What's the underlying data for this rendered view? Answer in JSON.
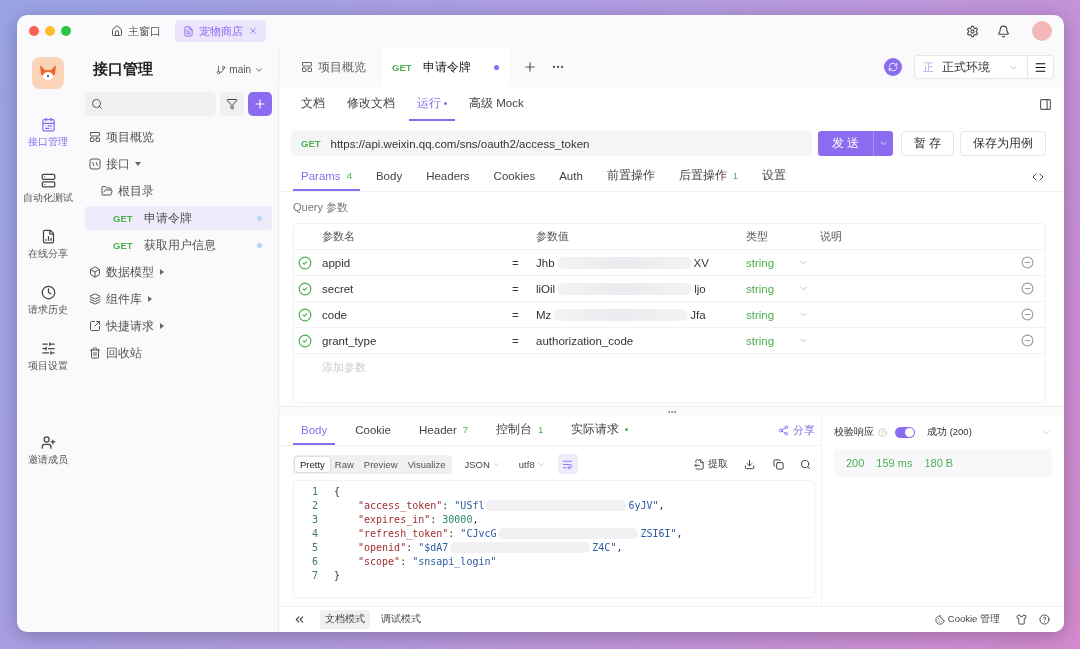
{
  "titlebar": {
    "tabs": [
      {
        "label": "主窗口",
        "selected": false
      },
      {
        "label": "宠物商店",
        "selected": true
      }
    ]
  },
  "rail": {
    "items": [
      {
        "label": "接口管理",
        "selected": true
      },
      {
        "label": "自动化测试",
        "selected": false
      },
      {
        "label": "在线分享",
        "selected": false
      },
      {
        "label": "请求历史",
        "selected": false
      },
      {
        "label": "项目设置",
        "selected": false
      },
      {
        "label": "邀请成员",
        "selected": false
      }
    ]
  },
  "sidebar": {
    "title": "接口管理",
    "branch": "main",
    "tree": [
      {
        "label": "项目概览",
        "kind": "page"
      },
      {
        "label": "接口",
        "kind": "group",
        "expanded": true,
        "children": [
          {
            "label": "根目录",
            "kind": "folder",
            "children": [
              {
                "kind": "api",
                "method": "GET",
                "label": "申请令牌",
                "selected": true
              },
              {
                "kind": "api",
                "method": "GET",
                "label": "获取用户信息",
                "selected": false
              }
            ]
          }
        ]
      },
      {
        "label": "数据模型",
        "kind": "group",
        "expanded": false
      },
      {
        "label": "组件库",
        "kind": "group",
        "expanded": false
      },
      {
        "label": "快捷请求",
        "kind": "group",
        "expanded": false
      },
      {
        "label": "回收站",
        "kind": "page"
      }
    ]
  },
  "doc_tabs": [
    {
      "kind": "overview",
      "label": "项目概览",
      "selected": false,
      "modified": false
    },
    {
      "kind": "api",
      "method": "GET",
      "label": "申请令牌",
      "selected": true,
      "modified": true
    }
  ],
  "environment": {
    "badge": "正",
    "label": "正式环境"
  },
  "sub_tabs": [
    {
      "label": "文档",
      "selected": false,
      "dot": false
    },
    {
      "label": "修改文档",
      "selected": false,
      "dot": false
    },
    {
      "label": "运行",
      "selected": true,
      "dot": true
    },
    {
      "label": "高级 Mock",
      "selected": false,
      "dot": false
    }
  ],
  "request": {
    "method": "GET",
    "url": "https://api.weixin.qq.com/sns/oauth2/access_token",
    "send": "发 送",
    "save": "暂 存",
    "save_case": "保存为用例"
  },
  "param_tabs": [
    {
      "label": "Params",
      "count": "4",
      "selected": true
    },
    {
      "label": "Body",
      "selected": false
    },
    {
      "label": "Headers",
      "selected": false
    },
    {
      "label": "Cookies",
      "selected": false
    },
    {
      "label": "Auth",
      "selected": false
    },
    {
      "label": "前置操作",
      "selected": false
    },
    {
      "label": "后置操作",
      "count": "1",
      "selected": false
    },
    {
      "label": "设置",
      "selected": false
    }
  ],
  "query": {
    "label": "Query 参数",
    "columns": [
      "参数名",
      "参数值",
      "类型",
      "说明"
    ],
    "rows": [
      {
        "enabled": true,
        "name": "appid",
        "operator": "=",
        "value_start": "Jhb",
        "masked": true,
        "value_end": "XV",
        "type": "string"
      },
      {
        "enabled": true,
        "name": "secret",
        "operator": "=",
        "value_start": "liOil",
        "masked": true,
        "value_end": "ljo",
        "type": "string"
      },
      {
        "enabled": true,
        "name": "code",
        "operator": "=",
        "value_start": "Mz",
        "masked": true,
        "value_end": "Jfa",
        "type": "string"
      },
      {
        "enabled": true,
        "name": "grant_type",
        "operator": "=",
        "value_start": "authorization_code",
        "masked": false,
        "type": "string"
      }
    ],
    "add_placeholder": "添加参数"
  },
  "response_tabs": [
    {
      "label": "Body",
      "selected": true,
      "dot": false
    },
    {
      "label": "Cookie",
      "selected": false,
      "dot": false
    },
    {
      "label": "Header",
      "count": "7",
      "selected": false,
      "dot": false
    },
    {
      "label": "控制台",
      "count": "1",
      "selected": false,
      "dot": false
    },
    {
      "label": "实际请求",
      "selected": false,
      "dot": true
    }
  ],
  "share": "分享",
  "view_modes": [
    {
      "label": "Pretty",
      "selected": true
    },
    {
      "label": "Raw",
      "selected": false
    },
    {
      "label": "Preview",
      "selected": false
    },
    {
      "label": "Visualize",
      "selected": false
    }
  ],
  "format": "JSON",
  "encoding": "utf8",
  "extract": "提取",
  "code": [
    {
      "n": "1",
      "tokens": [
        {
          "kind": "punct",
          "text": "{"
        }
      ]
    },
    {
      "n": "2",
      "tokens": [
        {
          "kind": "key",
          "text": "\"access_token\""
        },
        {
          "kind": "punct",
          "text": ": "
        },
        {
          "kind": "string",
          "text": "\"USfl",
          "masked": true
        },
        {
          "kind": "string",
          "text": "6yJV\""
        },
        {
          "kind": "punct",
          "text": ","
        }
      ]
    },
    {
      "n": "3",
      "tokens": [
        {
          "kind": "key",
          "text": "\"expires_in\""
        },
        {
          "kind": "punct",
          "text": ": "
        },
        {
          "kind": "number",
          "text": "30000"
        },
        {
          "kind": "punct",
          "text": ","
        }
      ]
    },
    {
      "n": "4",
      "tokens": [
        {
          "kind": "key",
          "text": "\"refresh_token\""
        },
        {
          "kind": "punct",
          "text": ": "
        },
        {
          "kind": "string",
          "text": "\"CJvcG",
          "masked": true
        },
        {
          "kind": "string",
          "text": "ZSI6I\""
        },
        {
          "kind": "punct",
          "text": ","
        }
      ]
    },
    {
      "n": "5",
      "tokens": [
        {
          "kind": "key",
          "text": "\"openid\""
        },
        {
          "kind": "punct",
          "text": ": "
        },
        {
          "kind": "string",
          "text": "\"$dA7",
          "masked": true
        },
        {
          "kind": "string",
          "text": "Z4C\""
        },
        {
          "kind": "punct",
          "text": ","
        }
      ]
    },
    {
      "n": "6",
      "tokens": [
        {
          "kind": "key",
          "text": "\"scope\""
        },
        {
          "kind": "punct",
          "text": ": "
        },
        {
          "kind": "string",
          "text": "\"snsapi_login\""
        }
      ]
    },
    {
      "n": "7",
      "tokens": [
        {
          "kind": "punct",
          "text": "}"
        }
      ]
    }
  ],
  "validation": {
    "label": "校验响应",
    "on": true,
    "result": "成功 (200)"
  },
  "stats": {
    "status": "200",
    "time": "159 ms",
    "size": "180 B"
  },
  "bottom_bar": {
    "modes": [
      {
        "label": "文档模式",
        "selected": true
      },
      {
        "label": "调试模式",
        "selected": false
      }
    ],
    "cookie": "Cookie 管理"
  }
}
